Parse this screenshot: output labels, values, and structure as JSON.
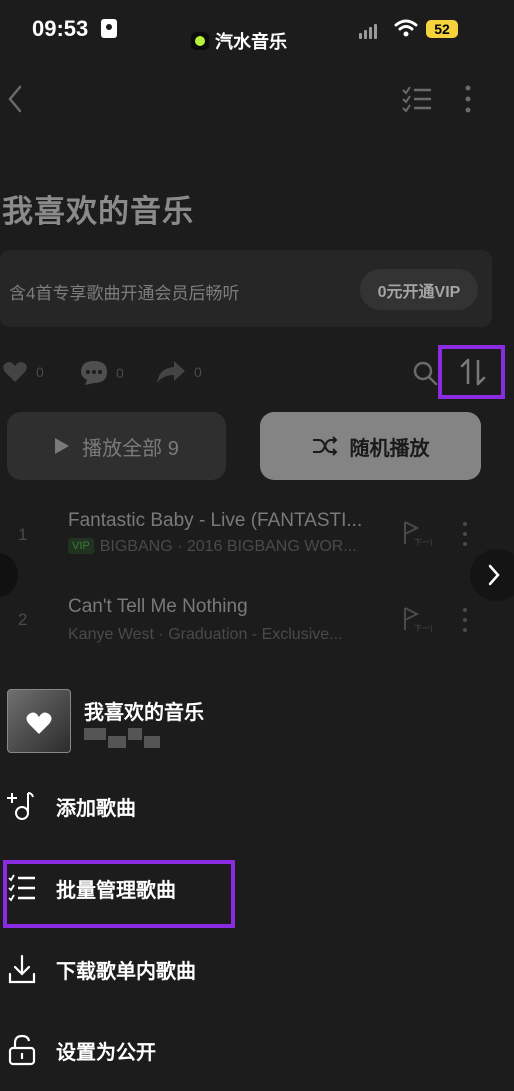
{
  "status_bar": {
    "time": "09:53",
    "app_name": "汽水音乐",
    "battery": "52"
  },
  "playlist": {
    "title": "我喜欢的音乐",
    "vip_notice": "含4首专享歌曲开通会员后畅听",
    "vip_button": "0元开通VIP",
    "likes": "0",
    "comments": "0",
    "shares": "0"
  },
  "actions": {
    "play_all": "播放全部 9",
    "shuffle": "随机播放"
  },
  "songs": [
    {
      "index": "1",
      "title": "Fantastic Baby - Live (FANTASTI...",
      "vip": "VIP",
      "subtitle": "BIGBANG · 2016 BIGBANG WOR...",
      "download_icon_text": "下一首"
    },
    {
      "index": "2",
      "title": "Can't Tell Me Nothing",
      "subtitle": "Kanye West · Graduation - Exclusive...",
      "download_icon_text": "下一首"
    }
  ],
  "sheet": {
    "title": "我喜欢的音乐",
    "menu": [
      {
        "label": "添加歌曲",
        "icon": "add-music-icon"
      },
      {
        "label": "批量管理歌曲",
        "icon": "checklist-icon"
      },
      {
        "label": "下载歌单内歌曲",
        "icon": "download-icon"
      },
      {
        "label": "设置为公开",
        "icon": "unlock-icon"
      }
    ]
  },
  "colors": {
    "highlight": "#8a2be2",
    "background": "#1c1c1c",
    "battery": "#f5d33d"
  }
}
